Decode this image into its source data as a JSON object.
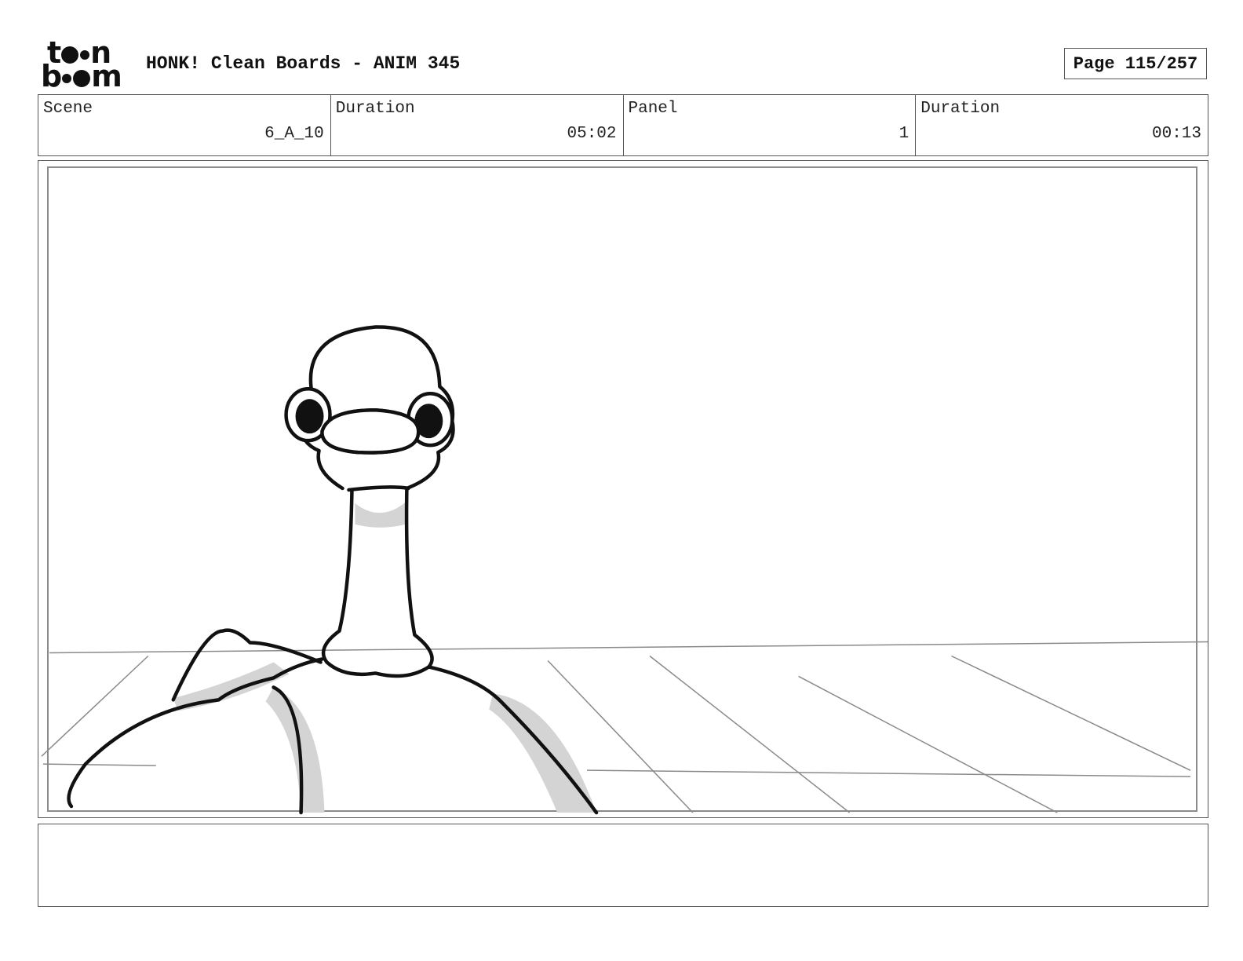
{
  "header": {
    "logo_line1": "toon",
    "logo_line2": "boom",
    "title": "HONK! Clean Boards - ANIM 345",
    "page_label": "Page 115/257"
  },
  "info": {
    "scene_label": "Scene",
    "scene_value": "6_A_10",
    "scene_duration_label": "Duration",
    "scene_duration_value": "05:02",
    "panel_label": "Panel",
    "panel_value": "1",
    "panel_duration_label": "Duration",
    "panel_duration_value": "00:13"
  },
  "panel": {
    "description": "",
    "notes": ""
  },
  "colors": {
    "ink": "#111111",
    "frame": "#555555",
    "shade": "#d0d0d0",
    "guide": "#8a8a8a"
  }
}
